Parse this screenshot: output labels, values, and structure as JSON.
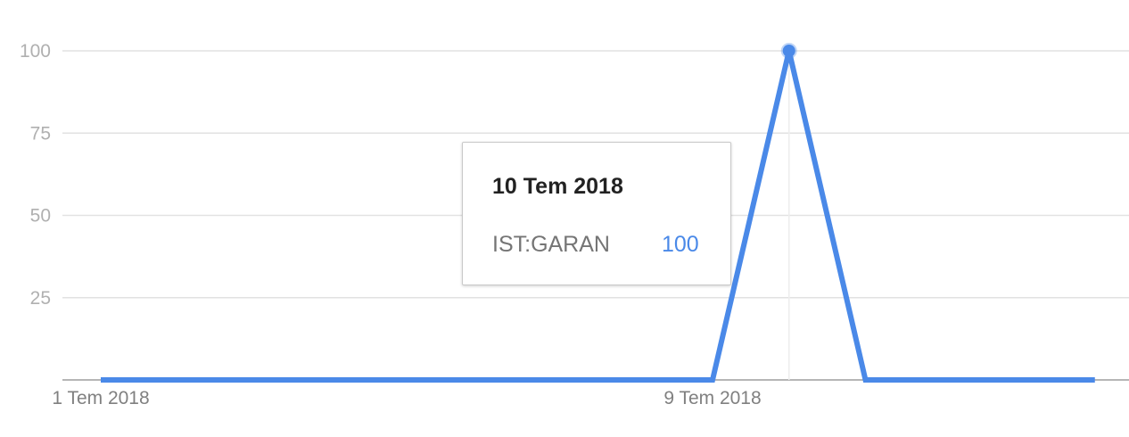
{
  "chart_data": {
    "type": "line",
    "x": [
      "1 Tem 2018",
      "2 Tem 2018",
      "3 Tem 2018",
      "4 Tem 2018",
      "5 Tem 2018",
      "6 Tem 2018",
      "7 Tem 2018",
      "8 Tem 2018",
      "9 Tem 2018",
      "10 Tem 2018",
      "11 Tem 2018",
      "12 Tem 2018",
      "13 Tem 2018",
      "14 Tem 2018"
    ],
    "series": [
      {
        "name": "IST:GARAN",
        "color": "#4a89e8",
        "values": [
          0,
          0,
          0,
          0,
          0,
          0,
          0,
          0,
          0,
          100,
          0,
          0,
          0,
          0
        ]
      }
    ],
    "ylim": [
      0,
      100
    ],
    "yticks": [
      "25",
      "50",
      "75",
      "100"
    ],
    "xticks": [
      {
        "index": 0,
        "label": "1 Tem 2018"
      },
      {
        "index": 8,
        "label": "9 Tem 2018"
      }
    ],
    "grid": true,
    "highlight_index": 9
  },
  "tooltip": {
    "date": "10 Tem 2018",
    "series": "IST:GARAN",
    "value": "100",
    "value_color": "#4a89e8"
  }
}
